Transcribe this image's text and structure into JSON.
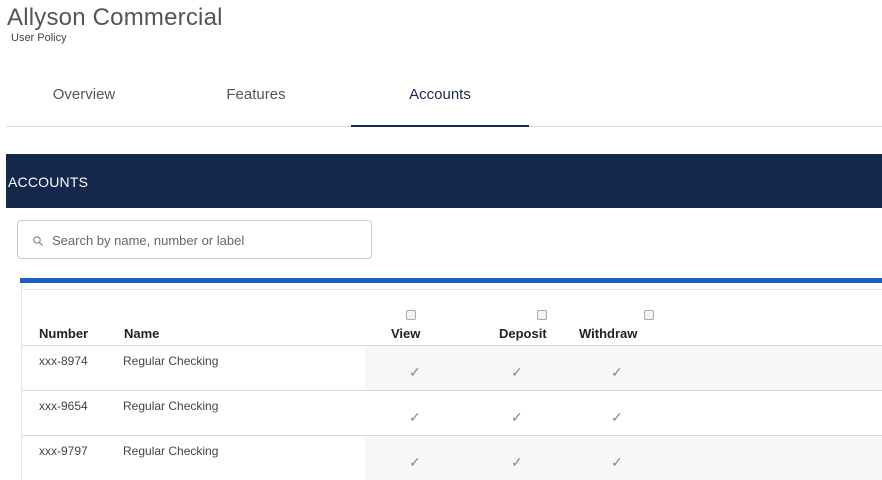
{
  "page": {
    "title": "Allyson Commercial",
    "subtitle": "User Policy"
  },
  "tabs": [
    {
      "label": "Overview",
      "active": false
    },
    {
      "label": "Features",
      "active": false
    },
    {
      "label": "Accounts",
      "active": true
    }
  ],
  "section": {
    "title": "ACCOUNTS"
  },
  "search": {
    "placeholder": "Search by name, number or label",
    "value": ""
  },
  "table": {
    "columns": [
      "Number",
      "Name",
      "View",
      "Deposit",
      "Withdraw"
    ],
    "rows": [
      {
        "number": "xxx-8974",
        "name": "Regular Checking",
        "view": "✓",
        "deposit": "✓",
        "withdraw": "✓"
      },
      {
        "number": "xxx-9654",
        "name": "Regular Checking",
        "view": "✓",
        "deposit": "✓",
        "withdraw": "✓"
      },
      {
        "number": "xxx-9797",
        "name": "Regular Checking",
        "view": "✓",
        "deposit": "✓",
        "withdraw": "✓"
      }
    ]
  },
  "colors": {
    "header_bg": "#14284b",
    "table_accent": "#1c5fc2",
    "active_tab_border": "#14284b"
  },
  "icons": {
    "search": "search-icon",
    "select_all": "checkbox-icon",
    "permission": "checkmark-icon"
  }
}
